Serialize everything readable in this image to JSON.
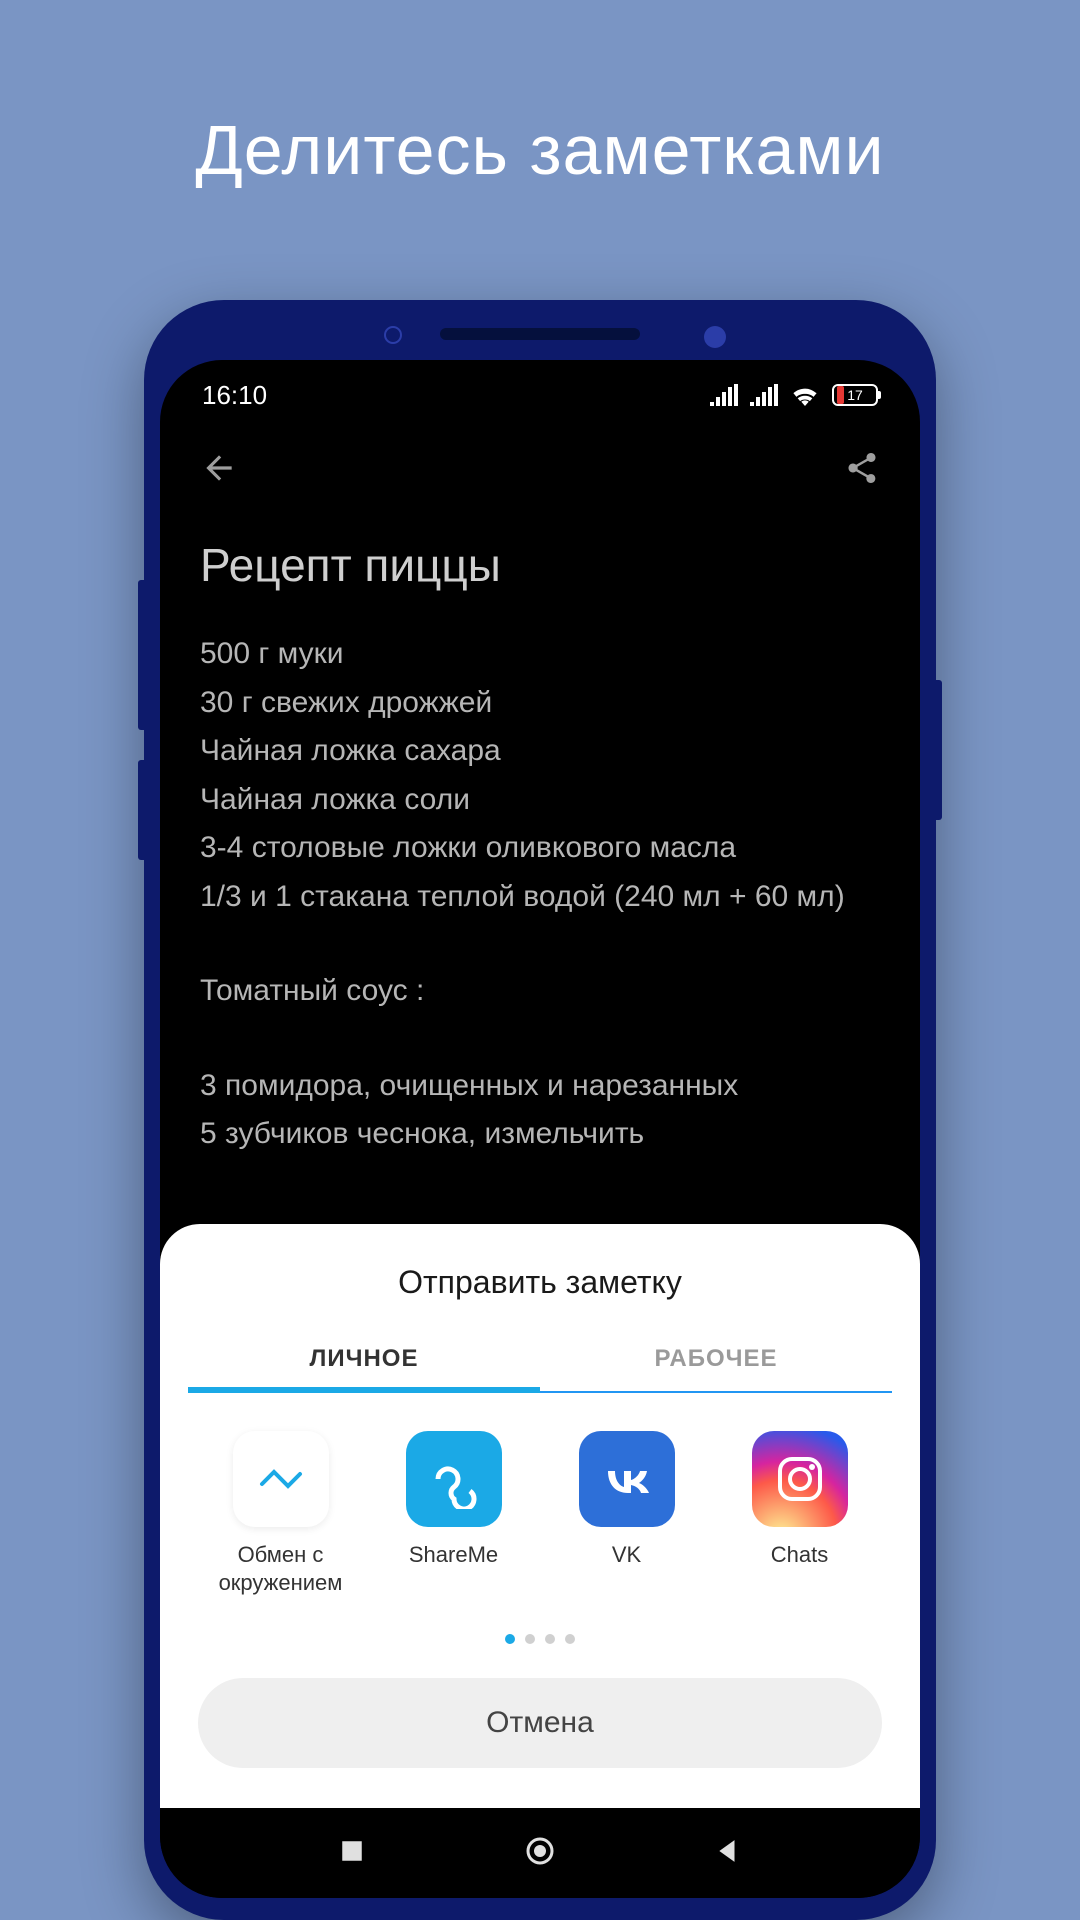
{
  "promo": {
    "title": "Делитесь заметками"
  },
  "statusbar": {
    "time": "16:10",
    "battery_pct": "17"
  },
  "note": {
    "title": "Рецепт пиццы",
    "lines": [
      "500 г муки",
      "30 г свежих дрожжей",
      "Чайная ложка сахара",
      "Чайная ложка соли",
      "3-4 столовые ложки оливкового масла",
      "1/3 и 1 стакана теплой водой (240 мл + 60 мл)"
    ],
    "section": "Томатный соус :",
    "lines2": [
      "3 помидора, очищенных и нарезанных",
      "5 зубчиков чеснока, измельчить"
    ]
  },
  "sheet": {
    "title": "Отправить заметку",
    "tabs": [
      {
        "label": "ЛИЧНОЕ",
        "active": true
      },
      {
        "label": "РАБОЧЕЕ",
        "active": false
      }
    ],
    "apps": [
      {
        "label": "Обмен с окружением",
        "icon": "nearby"
      },
      {
        "label": "ShareMe",
        "icon": "shareme"
      },
      {
        "label": "VK",
        "icon": "vk"
      },
      {
        "label": "Chats",
        "icon": "instagram"
      }
    ],
    "page_count": 4,
    "active_page": 0,
    "cancel": "Отмена"
  }
}
